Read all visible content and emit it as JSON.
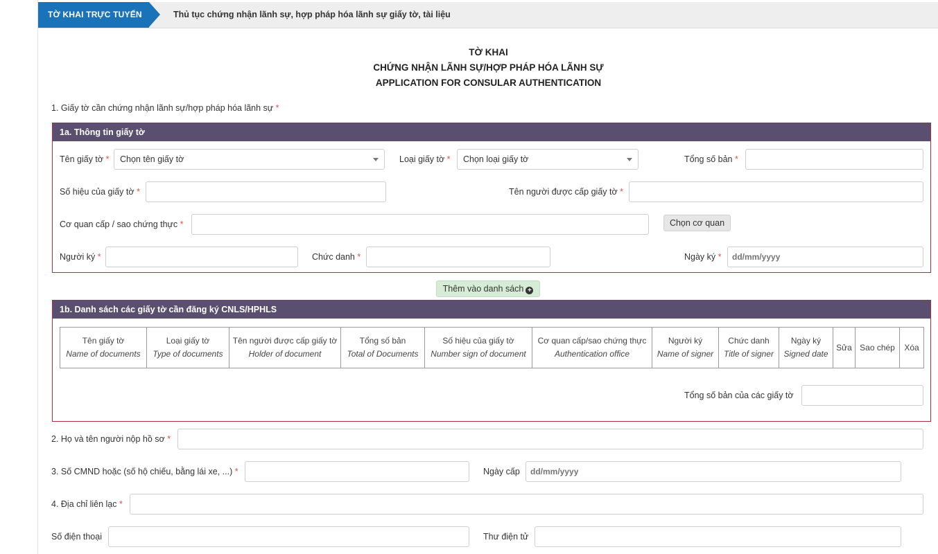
{
  "breadcrumb": {
    "tag": "TỜ KHAI TRỰC TUYẾN",
    "title": "Thủ tục chứng nhận lãnh sự, hợp pháp hóa lãnh sự giấy tờ, tài liệu"
  },
  "form_title": {
    "line1": "TỜ KHAI",
    "line2": "CHỨNG NHẬN LÃNH SỰ/HỢP PHÁP HÓA LÃNH SỰ",
    "line3": "APPLICATION FOR CONSULAR AUTHENTICATION"
  },
  "section1": {
    "label": "1. Giấy tờ cần chứng nhận lãnh sự/hợp pháp hóa lãnh sự",
    "required": "*"
  },
  "panel1a": {
    "title": "1a. Thông tin giấy tờ",
    "doc_name_label": "Tên giấy tờ",
    "doc_name_value": "Chọn tên giấy tờ",
    "doc_type_label": "Loại giấy tờ",
    "doc_type_value": "Chọn loại giấy tờ",
    "total_copies_label": "Tổng số bản",
    "doc_number_label": "Số hiệu của giấy tờ",
    "holder_label": "Tên người được cấp giấy tờ",
    "issuer_label": "Cơ quan cấp / sao chứng thực",
    "choose_agency_button": "Chọn cơ quan",
    "signer_label": "Người ký",
    "title_label": "Chức danh",
    "sign_date_label": "Ngày ký",
    "sign_date_placeholder": "dd/mm/yyyy",
    "required": "*"
  },
  "add_to_list_button": "Thêm vào danh sách",
  "panel1b": {
    "title": "1b. Danh sách các giấy tờ cần đăng ký CNLS/HPHLS",
    "columns": [
      {
        "vi": "Tên giấy tờ",
        "en": "Name of documents"
      },
      {
        "vi": "Loại giấy tờ",
        "en": "Type of documents"
      },
      {
        "vi": "Tên người được cấp giấy tờ",
        "en": "Holder of document"
      },
      {
        "vi": "Tổng số bản",
        "en": "Total of Documents"
      },
      {
        "vi": "Số hiệu của giấy tờ",
        "en": "Number sign of document"
      },
      {
        "vi": "Cơ quan cấp/sao chứng thực",
        "en": "Authentication office"
      },
      {
        "vi": "Người ký",
        "en": "Name of signer"
      },
      {
        "vi": "Chức danh",
        "en": "Title of signer"
      },
      {
        "vi": "Ngày ký",
        "en": "Signed date"
      },
      {
        "vi": "Sửa",
        "en": ""
      },
      {
        "vi": "Sao chép",
        "en": ""
      },
      {
        "vi": "Xóa",
        "en": ""
      }
    ],
    "total_label": "Tổng số bản của các giấy tờ"
  },
  "section2": {
    "label": "2. Họ và tên người nộp hồ sơ",
    "required": "*"
  },
  "section3": {
    "label": "3. Số CMND hoặc (số hộ chiếu, bằng lái xe, ...)",
    "required": "*",
    "issue_date_label": "Ngày cấp",
    "issue_date_placeholder": "dd/mm/yyyy"
  },
  "section4": {
    "label": "4. Địa chỉ liên lạc",
    "required": "*",
    "phone_label": "Số điện thoại",
    "email_label": "Thư điện tử"
  },
  "colors": {
    "breadcrumb_blue": "#1a73b8",
    "panel_header": "#5a4f6f",
    "panel_border": "#b02c3b",
    "required_red": "#d9534f",
    "add_button_green": "#d7ecd7"
  }
}
